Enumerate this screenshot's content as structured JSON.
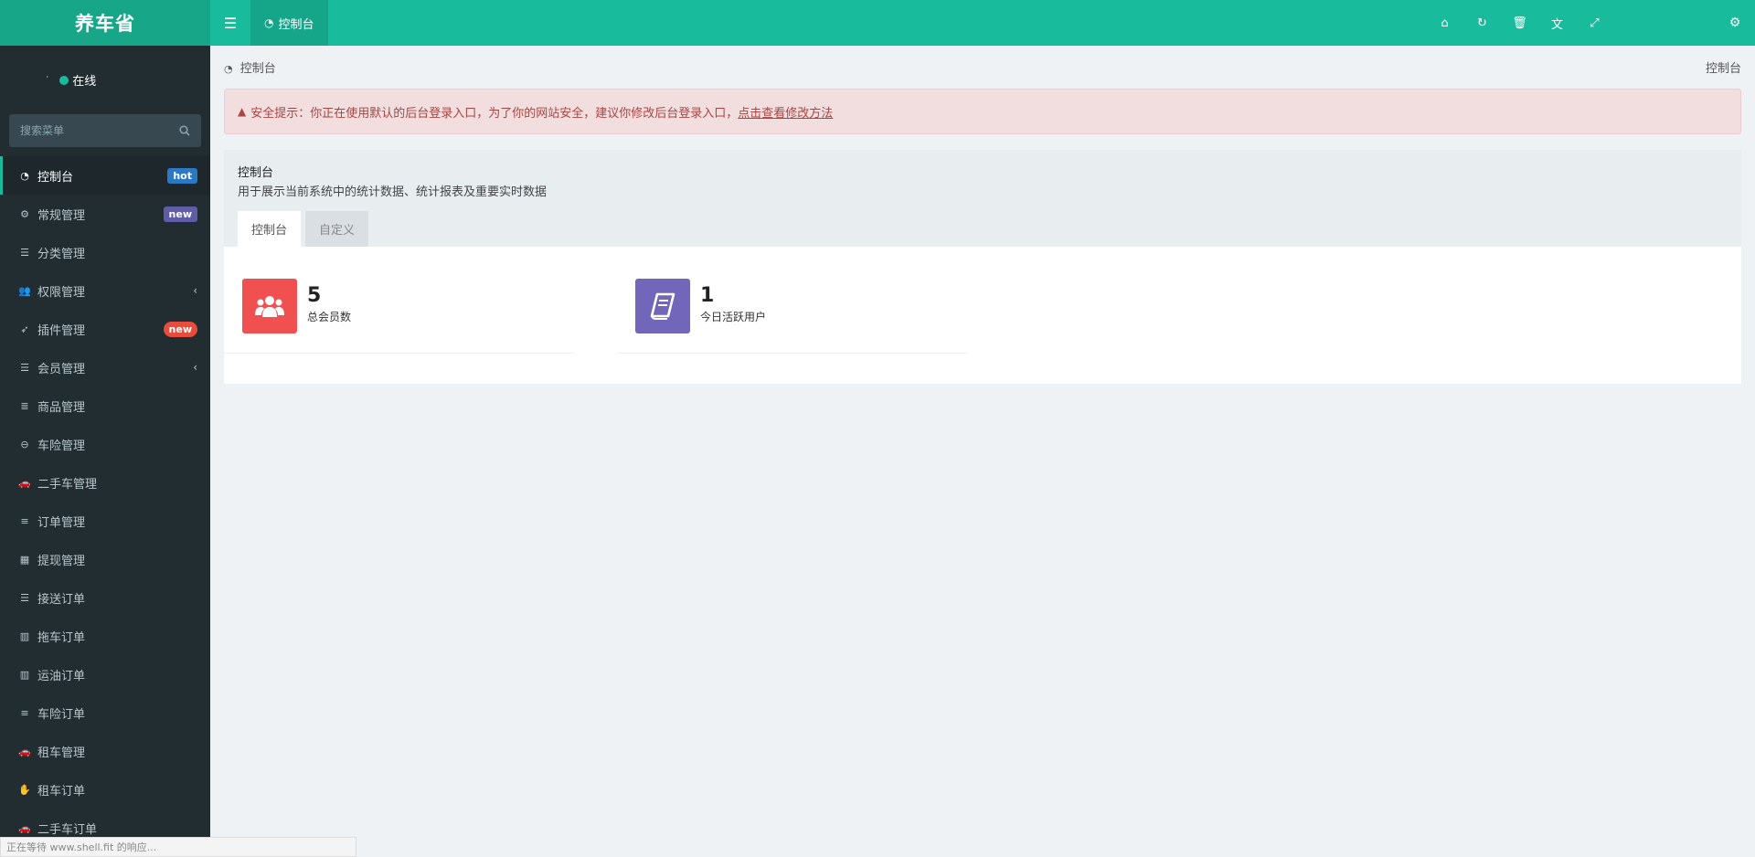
{
  "sidebar": {
    "logo": "养车省",
    "user_status": "在线",
    "search_placeholder": "搜索菜单",
    "items": [
      {
        "label": "控制台",
        "icon": "dashboard-icon",
        "badge": "hot"
      },
      {
        "label": "常规管理",
        "icon": "cogs-icon",
        "badge": "new"
      },
      {
        "label": "分类管理",
        "icon": "list-icon"
      },
      {
        "label": "权限管理",
        "icon": "users-icon"
      },
      {
        "label": "插件管理",
        "icon": "rocket-icon",
        "badge": "new"
      },
      {
        "label": "会员管理",
        "icon": "list-icon"
      },
      {
        "label": "商品管理",
        "icon": "database-icon"
      },
      {
        "label": "车险管理",
        "icon": "minus-circle-icon"
      },
      {
        "label": "二手车管理",
        "icon": "car-icon"
      },
      {
        "label": "订单管理",
        "icon": "align-left-icon"
      },
      {
        "label": "提现管理",
        "icon": "calculator-icon"
      },
      {
        "label": "接送订单",
        "icon": "list-icon"
      },
      {
        "label": "拖车订单",
        "icon": "bar-chart-icon"
      },
      {
        "label": "运油订单",
        "icon": "bar-chart-icon"
      },
      {
        "label": "车险订单",
        "icon": "align-left-icon"
      },
      {
        "label": "租车管理",
        "icon": "car-icon"
      },
      {
        "label": "租车订单",
        "icon": "handshake-icon"
      },
      {
        "label": "二手车订单",
        "icon": "car-icon"
      }
    ]
  },
  "header": {
    "tab_label": "控制台"
  },
  "breadcrumb": {
    "left": "控制台",
    "right": "控制台"
  },
  "alert": {
    "text": "安全提示：你正在使用默认的后台登录入口，为了你的网站安全，建议你修改后台登录入口，",
    "link": "点击查看修改方法"
  },
  "panel": {
    "title": "控制台",
    "subtitle": "用于展示当前系统中的统计数据、统计报表及重要实时数据",
    "tabs": [
      "控制台",
      "自定义"
    ]
  },
  "stats": [
    {
      "value": "5",
      "label": "总会员数",
      "color": "#f05050",
      "icon": "users-icon"
    },
    {
      "value": "1",
      "label": "今日活跃用户",
      "color": "#7266ba",
      "icon": "book-icon"
    }
  ],
  "status_bar": "正在等待 www.shell.fit 的响应...",
  "colors": {
    "accent": "#18bc9c",
    "sidebar_bg": "#222d32"
  }
}
